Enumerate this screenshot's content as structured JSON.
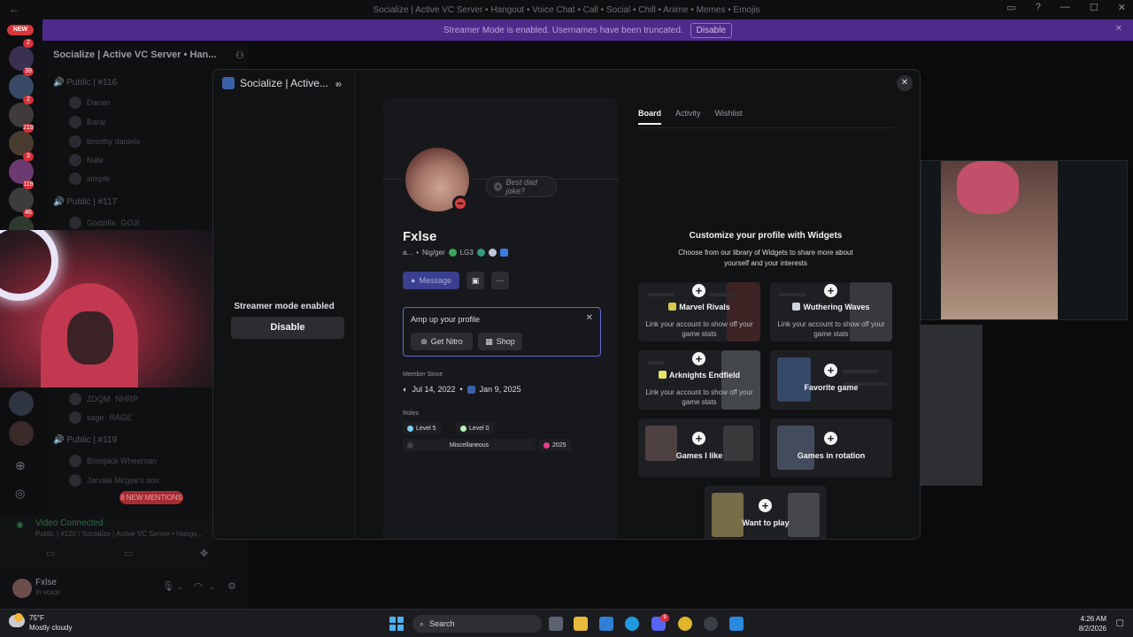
{
  "window": {
    "title": "Socialize | Active VC Server • Hangout • Voice Chat • Call • Social • Chill • Anime • Memes • Emojis"
  },
  "banner": {
    "text": "Streamer Mode is enabled. Usernames have been truncated.",
    "button": "Disable"
  },
  "rail": {
    "new_badge": "NEW",
    "pings": [
      "2",
      "39",
      "2",
      "219",
      "3",
      "119",
      "46"
    ]
  },
  "sidebar": {
    "server_name": "Socialize | Active VC Server • Han...",
    "channels": [
      {
        "label": "Public | #116",
        "members": [
          "Darain",
          "Barai",
          "timothy daniels",
          "Nate",
          "simple"
        ]
      },
      {
        "label": "Public | #117",
        "members": [
          "Godzilla"
        ]
      },
      {
        "label": "Public | #119",
        "members": [
          "Blowjack Wheeman",
          "Jarvale Mcgee's son"
        ]
      }
    ],
    "extra_members": [
      {
        "name": "ZDQM",
        "tag": "NHRP"
      },
      {
        "name": "sage",
        "tag": "RAGE"
      }
    ],
    "godzilla_tag": "GOJI",
    "new_mentions": "8 NEW MENTIONS",
    "voice": {
      "status": "Video Connected",
      "channel": "Public | #120 / Socialize | Active VC Server • Hango..."
    },
    "user": {
      "name": "Fxlse",
      "status": "In voice"
    }
  },
  "modal": {
    "server_selector": "Socialize | Active...",
    "streamer_mode_text": "Streamer mode enabled",
    "streamer_mode_button": "Disable",
    "profile": {
      "status_placeholder": "Best dad joke?",
      "display_name": "Fxlse",
      "username": "a...",
      "pronouns": "Nig/ger",
      "guild_tag": "LG3",
      "message_button": "Message",
      "amp_title": "Amp up your profile",
      "get_nitro": "Get Nitro",
      "shop": "Shop",
      "member_since_label": "Member Since",
      "discord_since": "Jul 14, 2022",
      "server_since": "Jan 9, 2025",
      "roles_label": "Roles",
      "roles": [
        "Level 5",
        "Level 0",
        "Miscellaneous",
        "2025"
      ]
    },
    "tabs": [
      "Board",
      "Activity",
      "Wishlist"
    ],
    "widgets": {
      "title": "Customize your profile with Widgets",
      "subtitle": "Choose from our library of Widgets to share more about yourself and your interests",
      "cards": [
        {
          "title": "Marvel Rivals",
          "desc": "Link your account to show off your game stats"
        },
        {
          "title": "Wuthering Waves",
          "desc": "Link your account to show off your game stats"
        },
        {
          "title": "Arknights Endfield",
          "desc": "Link your account to show off your game stats"
        },
        {
          "title": "Favorite game",
          "desc": ""
        },
        {
          "title": "Games I like",
          "desc": ""
        },
        {
          "title": "Games in rotation",
          "desc": ""
        },
        {
          "title": "Want to play",
          "desc": ""
        }
      ]
    }
  },
  "taskbar": {
    "temperature": "75°F",
    "condition": "Mostly cloudy",
    "search": "Search",
    "time": "4:26 AM",
    "date": "8/2/2026",
    "discord_badge": "9"
  },
  "colors": {
    "blurple": "#5865f2",
    "dnd_red": "#d83c3e",
    "streamer_purple": "#4e2a8a"
  }
}
